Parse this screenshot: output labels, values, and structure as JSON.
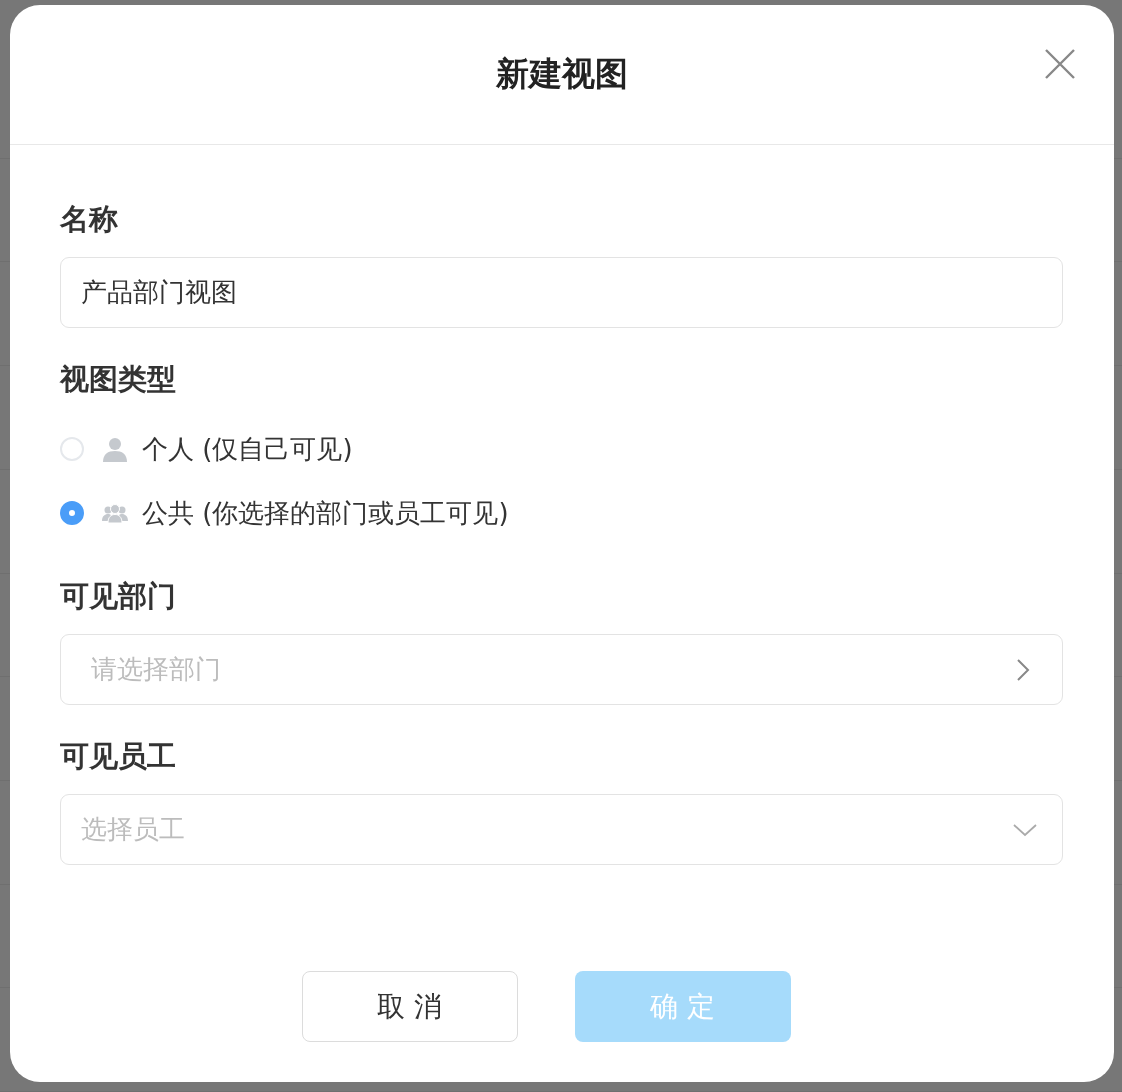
{
  "dialog": {
    "title": "新建视图"
  },
  "name_field": {
    "label": "名称",
    "value": "产品部门视图"
  },
  "view_type": {
    "label": "视图类型",
    "options": [
      {
        "kind": "personal",
        "label": "个人 (仅自己可见)",
        "selected": false
      },
      {
        "kind": "public",
        "label": "公共 (你选择的部门或员工可见)",
        "selected": true
      }
    ]
  },
  "department_field": {
    "label": "可见部门",
    "placeholder": "请选择部门"
  },
  "employee_field": {
    "label": "可见员工",
    "placeholder": "选择员工"
  },
  "buttons": [
    {
      "kind": "secondary",
      "label": "取 消",
      "disabled": false
    },
    {
      "kind": "primary",
      "label": "确 定",
      "disabled": true
    }
  ]
}
